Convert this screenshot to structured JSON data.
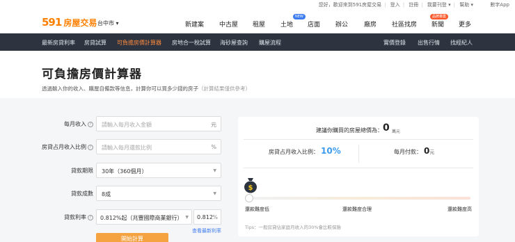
{
  "topbar": {
    "links": [
      "您好，歡迎來到591房屋交易",
      "登入",
      "註冊",
      "我要刊登 ▾",
      "幫助 ▾"
    ],
    "app": "數字App"
  },
  "header": {
    "logo_number": "591",
    "logo_text": "房屋交易",
    "city": "台中市 ▾",
    "nav": [
      {
        "label": "新建案"
      },
      {
        "label": "中古屋"
      },
      {
        "label": "租屋"
      },
      {
        "label": "土地",
        "badge": "NEW"
      },
      {
        "label": "店面"
      },
      {
        "label": "辦公"
      },
      {
        "label": "廠房"
      },
      {
        "label": "社區找房"
      },
      {
        "label": "新聞",
        "badge": "品牌專案"
      },
      {
        "label": "更多"
      }
    ]
  },
  "subnav": {
    "left": [
      "最新房貸利率",
      "房貸試算",
      "可負擔房價計算器",
      "房地合一稅試算",
      "海砂屋查詢",
      "購屋流程"
    ],
    "active": "可負擔房價計算器",
    "right": [
      "實價登錄",
      "出售行情",
      "找經紀人"
    ]
  },
  "page": {
    "title": "可負擔房價計算器",
    "subtitle": "透過輸入你的收入、購屋自備款等信息，計算你可以買多少錢的房子",
    "subtitle_hint": "（計算結果僅供參考）"
  },
  "form": {
    "income": {
      "label": "每月收入",
      "placeholder": "請輸入每月收入金額",
      "unit": "元"
    },
    "ratio": {
      "label": "房貸占月收入比例",
      "placeholder": "請輸入每月還款比例",
      "unit": "%"
    },
    "period": {
      "label": "貸款期限",
      "value": "30年（360個月）"
    },
    "loan_pct": {
      "label": "貸款成數",
      "value": "8成"
    },
    "rate": {
      "label": "貸款利率",
      "value": "0.812%起（兆豐國際商業銀行）",
      "input": "0.812",
      "unit": "%"
    },
    "latest_link": "查看最新利率",
    "submit": "開始計算"
  },
  "result": {
    "total_label": "建議你購買的房屋總價為：",
    "total_value": "0",
    "total_unit": "萬元",
    "ratio_label": "房貸占月收入比例：",
    "ratio_value": "10%",
    "payment_label": "每月付款：",
    "payment_value": "0",
    "payment_unit": "元",
    "scale_low": "還款難度低",
    "scale_mid": "還款難度合理",
    "scale_high": "還款難度高",
    "slider_fraction": 0,
    "tips": "Tips：一般房貸佔家庭月收入的30%會比較保險"
  },
  "colors": {
    "brand": "#ff8000",
    "subnav": "#2d3440",
    "accent": "#3d9cf0",
    "button": "#f5a340"
  }
}
